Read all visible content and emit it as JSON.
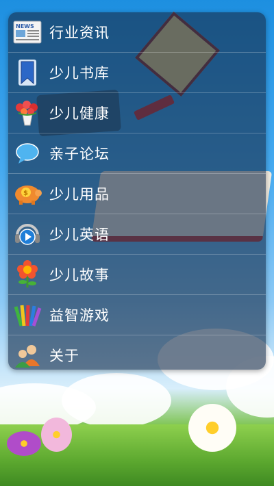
{
  "menu": {
    "items": [
      {
        "label": "行业资讯",
        "icon": "newspaper-icon"
      },
      {
        "label": "少儿书库",
        "icon": "bookmark-icon"
      },
      {
        "label": "少儿健康",
        "icon": "flowers-icon"
      },
      {
        "label": "亲子论坛",
        "icon": "speech-bubble-icon"
      },
      {
        "label": "少儿用品",
        "icon": "piggy-bank-icon"
      },
      {
        "label": "少儿英语",
        "icon": "audio-headphones-icon"
      },
      {
        "label": "少儿故事",
        "icon": "flower-icon"
      },
      {
        "label": "益智游戏",
        "icon": "crayons-icon"
      },
      {
        "label": "关于",
        "icon": "users-icon"
      }
    ],
    "newspaper_icon_text": "NEWS"
  }
}
